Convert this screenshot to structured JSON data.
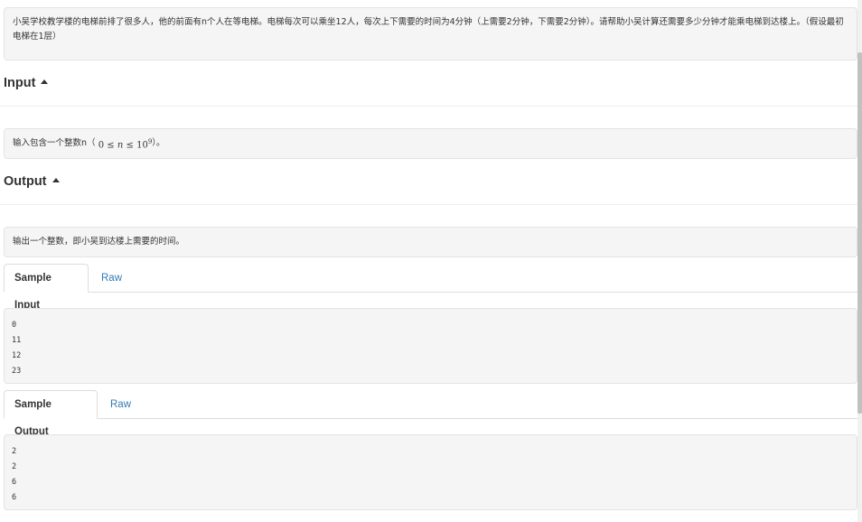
{
  "problem": {
    "description": "小吴学校教学楼的电梯前排了很多人，他的前面有n个人在等电梯。电梯每次可以乘坐12人，每次上下需要的时间为4分钟（上需要2分钟，下需要2分钟）。请帮助小吴计算还需要多少分钟才能乘电梯到达楼上。（假设最初电梯在1层）"
  },
  "input_section": {
    "heading": "Input",
    "text_prefix": "输入包含一个整数n（",
    "math_lower": "0",
    "math_le1": "≤",
    "math_var": "n",
    "math_le2": "≤",
    "math_base": "10",
    "math_exp": "9",
    "text_suffix": "）。"
  },
  "output_section": {
    "heading": "Output",
    "text": "输出一个整数，即小吴到达楼上需要的时间。"
  },
  "sample_input": {
    "tab_label": "Sample Input",
    "raw_label": "Raw",
    "lines": [
      "0",
      "11",
      "12",
      "23"
    ]
  },
  "sample_output": {
    "tab_label": "Sample Output",
    "raw_label": "Raw",
    "lines": [
      "2",
      "2",
      "6",
      "6"
    ]
  }
}
